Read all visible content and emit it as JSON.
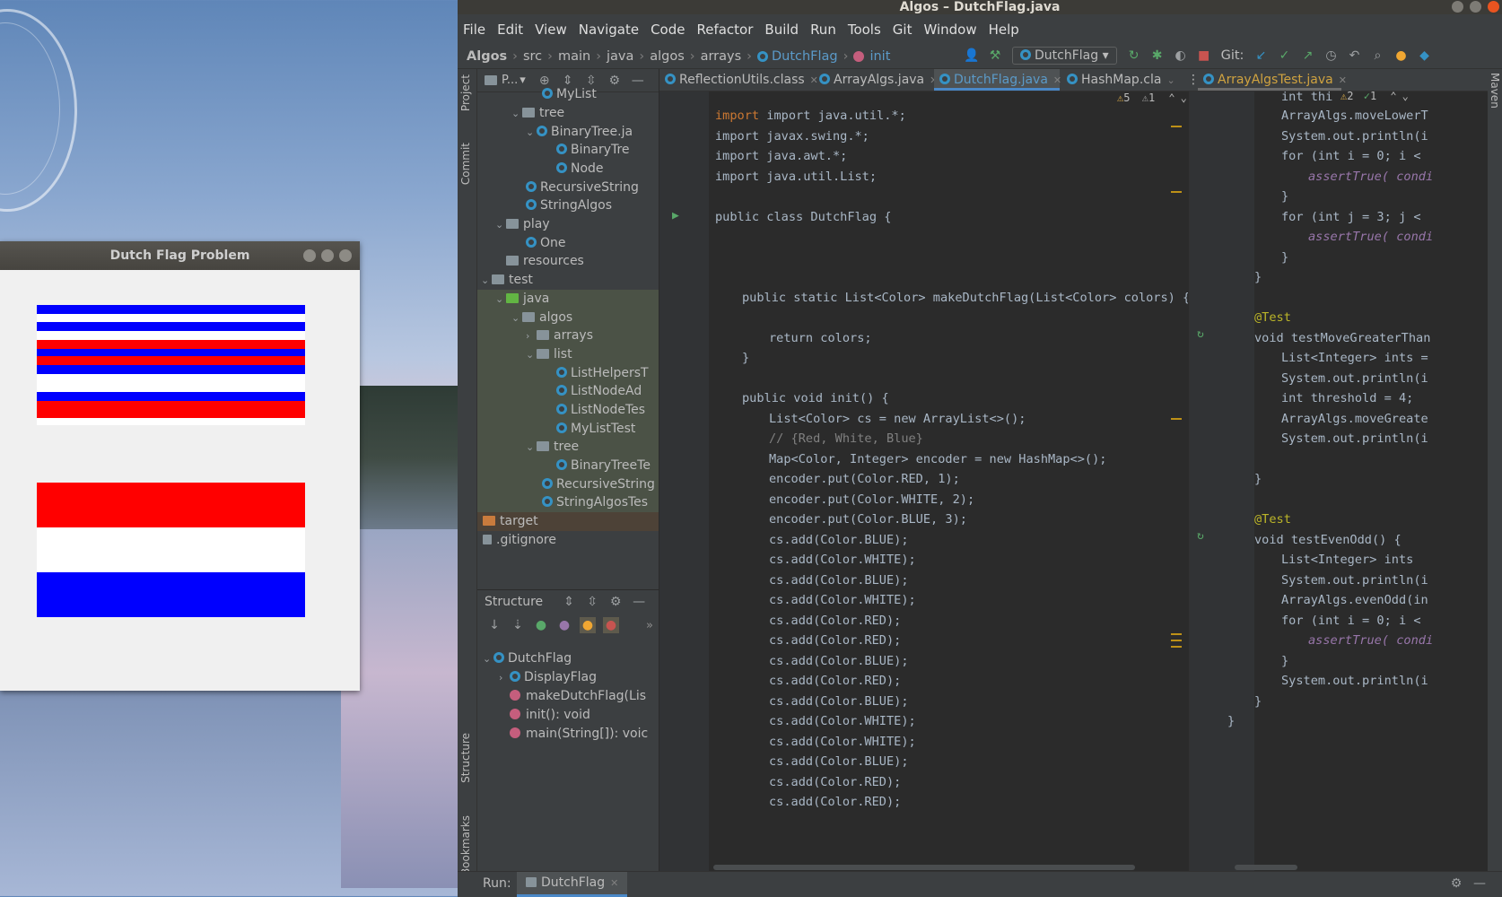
{
  "window_title": "Algos – DutchFlag.java",
  "flag_window": {
    "title": "Dutch Flag Problem",
    "colors": {
      "red": "#ff0000",
      "white": "#ffffff",
      "blue": "#0000ff"
    }
  },
  "menu": [
    "File",
    "Edit",
    "View",
    "Navigate",
    "Code",
    "Refactor",
    "Build",
    "Run",
    "Tools",
    "Git",
    "Window",
    "Help"
  ],
  "breadcrumb": [
    "Algos",
    "src",
    "main",
    "java",
    "algos",
    "arrays",
    "DutchFlag",
    "init"
  ],
  "run_config": "DutchFlag",
  "git_label": "Git:",
  "left_stripe": {
    "project": "Project",
    "commit": "Commit",
    "structure": "Structure",
    "bookmarks": "Bookmarks"
  },
  "project_panel": {
    "header": "P...",
    "rows": [
      "MyList",
      "tree",
      "BinaryTree.ja",
      "BinaryTre",
      "Node",
      "RecursiveString",
      "StringAlgos",
      "play",
      "One",
      "resources",
      "test",
      "java",
      "algos",
      "arrays",
      "list",
      "ListHelpersT",
      "ListNodeAd",
      "ListNodeTes",
      "MyListTest",
      "tree",
      "BinaryTreeTe",
      "RecursiveString",
      "StringAlgosTes",
      "target",
      ".gitignore"
    ]
  },
  "structure_panel": {
    "title": "Structure",
    "items": [
      "DutchFlag",
      "DisplayFlag",
      "makeDutchFlag(Lis",
      "init(): void",
      "main(String[]): voic"
    ]
  },
  "tabs": [
    "ReflectionUtils.class",
    "ArrayAlgs.java",
    "DutchFlag.java",
    "HashMap.cla"
  ],
  "right_tab": "ArrayAlgsTest.java",
  "inspections": {
    "warnings": "5",
    "weak": "1",
    "right_warnings": "2",
    "right_ok": "1"
  },
  "code_main": [
    "import java.util.*;",
    "import javax.swing.*;",
    "import java.awt.*;",
    "import java.util.List;",
    "public class DutchFlag {",
    "public static List<Color> makeDutchFlag(List<Color> colors) {",
    "return colors;",
    "}",
    "public void init() {",
    "List<Color> cs = new ArrayList<>();",
    "// {Red, White, Blue}",
    "Map<Color, Integer> encoder = new HashMap<>();",
    "encoder.put(Color.RED, 1);",
    "encoder.put(Color.WHITE, 2);",
    "encoder.put(Color.BLUE, 3);",
    "cs.add(Color.BLUE);",
    "cs.add(Color.WHITE);",
    "cs.add(Color.BLUE);",
    "cs.add(Color.WHITE);",
    "cs.add(Color.RED);",
    "cs.add(Color.RED);",
    "cs.add(Color.BLUE);",
    "cs.add(Color.RED);",
    "cs.add(Color.BLUE);",
    "cs.add(Color.WHITE);",
    "cs.add(Color.WHITE);",
    "cs.add(Color.BLUE);",
    "cs.add(Color.RED);",
    "cs.add(Color.RED);"
  ],
  "code_right": [
    "int thi",
    "ArrayAlgs.moveLowerT",
    "System.out.println(i",
    "for (int i = 0; i <",
    "assertTrue( condi",
    "}",
    "for (int j = 3; j <",
    "assertTrue( condi",
    "}",
    "}",
    "@Test",
    "void testMoveGreaterThan",
    "List<Integer> ints =",
    "System.out.println(i",
    "int threshold = 4;",
    "ArrayAlgs.moveGreate",
    "System.out.println(i",
    "}",
    "@Test",
    "void testEvenOdd() {",
    "List<Integer> ints",
    "System.out.println(i",
    "ArrayAlgs.evenOdd(in",
    "for (int i = 0; i <",
    "assertTrue( condi",
    "}",
    "System.out.println(i",
    "}",
    "}"
  ],
  "bottom": {
    "run_label": "Run:",
    "run_tab": "DutchFlag"
  },
  "maven": "Maven"
}
